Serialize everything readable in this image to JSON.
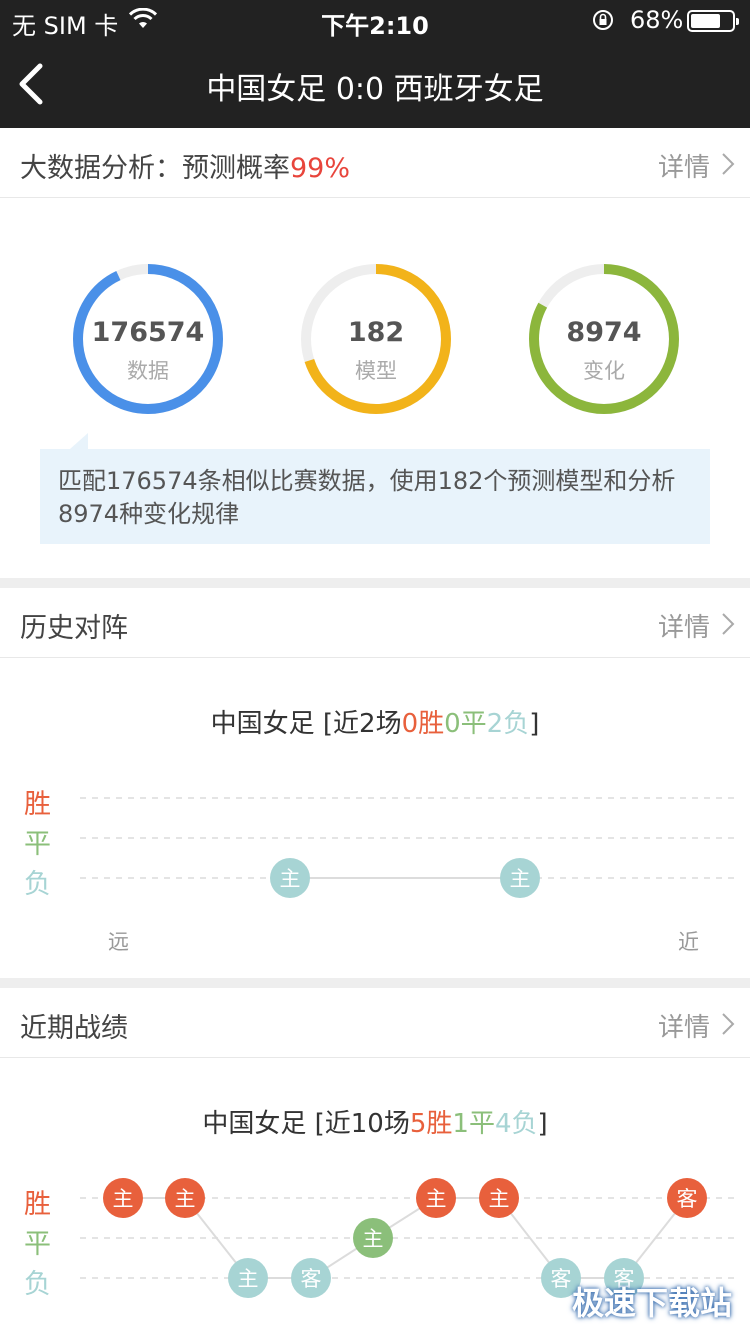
{
  "status": {
    "carrier": "无 SIM 卡",
    "time": "下午2:10",
    "battery": "68%",
    "battery_fraction": 0.68
  },
  "nav": {
    "title": "中国女足 0:0 西班牙女足"
  },
  "bigdata": {
    "label": "大数据分析：预测概率",
    "prob": "99%",
    "detail": "详情",
    "rings": [
      {
        "value": "176574",
        "caption": "数据",
        "color": "#4a90e8",
        "fraction": 0.93
      },
      {
        "value": "182",
        "caption": "模型",
        "color": "#f2b31a",
        "fraction": 0.7
      },
      {
        "value": "8974",
        "caption": "变化",
        "color": "#8cb63c",
        "fraction": 0.83
      }
    ],
    "tip": "匹配176574条相似比赛数据，使用182个预测模型和分析8974种变化规律"
  },
  "history": {
    "label": "历史对阵",
    "detail": "详情",
    "team": "中国女足",
    "prefix": " [近2场",
    "wins": "0胜",
    "draws": "0平",
    "losses": "2负",
    "suffix": "]",
    "legend": [
      "胜",
      "平",
      "负"
    ],
    "far": "远",
    "near": "近",
    "chart_data": {
      "type": "line",
      "levels": [
        "胜",
        "平",
        "负"
      ],
      "points": [
        {
          "result": "负",
          "venue": "主"
        },
        {
          "result": "负",
          "venue": "主"
        }
      ]
    }
  },
  "recent": {
    "label": "近期战绩",
    "detail": "详情",
    "team": "中国女足",
    "prefix": " [近10场",
    "wins": "5胜",
    "draws": "1平",
    "losses": "4负",
    "suffix": "]",
    "legend": [
      "胜",
      "平",
      "负"
    ],
    "chart_data": {
      "type": "line",
      "levels": [
        "胜",
        "平",
        "负"
      ],
      "points": [
        {
          "result": "胜",
          "venue": "主"
        },
        {
          "result": "胜",
          "venue": "主"
        },
        {
          "result": "负",
          "venue": "主"
        },
        {
          "result": "负",
          "venue": "客"
        },
        {
          "result": "平",
          "venue": "主"
        },
        {
          "result": "胜",
          "venue": "主"
        },
        {
          "result": "胜",
          "venue": "主"
        },
        {
          "result": "负",
          "venue": "客"
        },
        {
          "result": "负",
          "venue": "客"
        },
        {
          "result": "胜",
          "venue": "客"
        }
      ]
    }
  },
  "colors": {
    "win": "#e8603c",
    "draw": "#8bbf7a",
    "loss": "#a7d4d4"
  },
  "watermark": "极速下载站"
}
